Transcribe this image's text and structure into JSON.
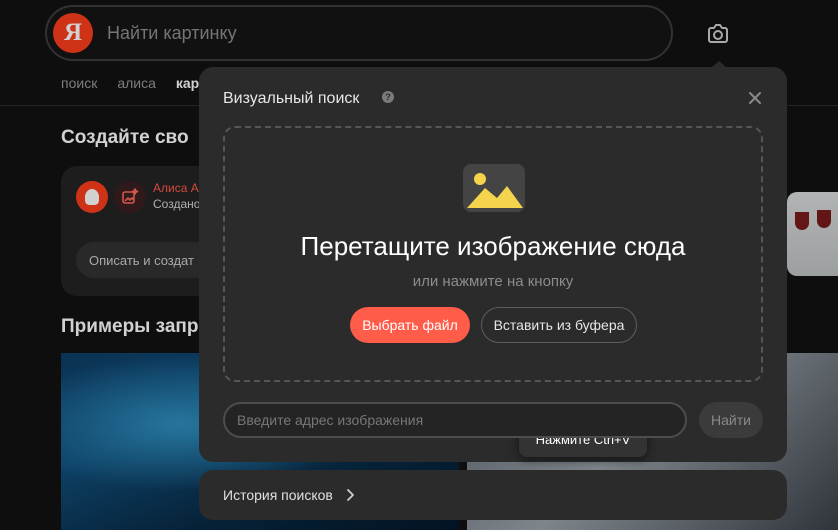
{
  "search": {
    "logo_letter": "Я",
    "placeholder": "Найти картинку"
  },
  "nav": {
    "items": [
      "поиск",
      "алиса",
      "кар"
    ]
  },
  "background": {
    "create_heading": "Создайте сво",
    "alice_name": "Алиса А",
    "alice_sub": "Создано",
    "describe_placeholder": "Описать и создат",
    "examples_heading": "Примеры запр"
  },
  "modal": {
    "title": "Визуальный поиск",
    "help_symbol": "?",
    "drop_title": "Перетащите изображение сюда",
    "drop_subtitle": "или нажмите на кнопку",
    "choose_file_label": "Выбрать файл",
    "paste_label": "Вставить из буфера",
    "paste_hint": "Нажмите Ctrl+V",
    "url_placeholder": "Введите адрес изображения",
    "find_label": "Найти"
  },
  "history": {
    "label": "История поисков"
  },
  "colors": {
    "brand_red": "#fc3f1d",
    "accent_button": "#ff5c4a",
    "modal_bg": "#2b2b2b",
    "image_icon_yellow": "#f5d44d"
  },
  "icons": {
    "camera": "camera-icon",
    "close": "close-icon",
    "help": "help-icon",
    "image": "image-icon",
    "chevron": "chevron-right-icon"
  }
}
